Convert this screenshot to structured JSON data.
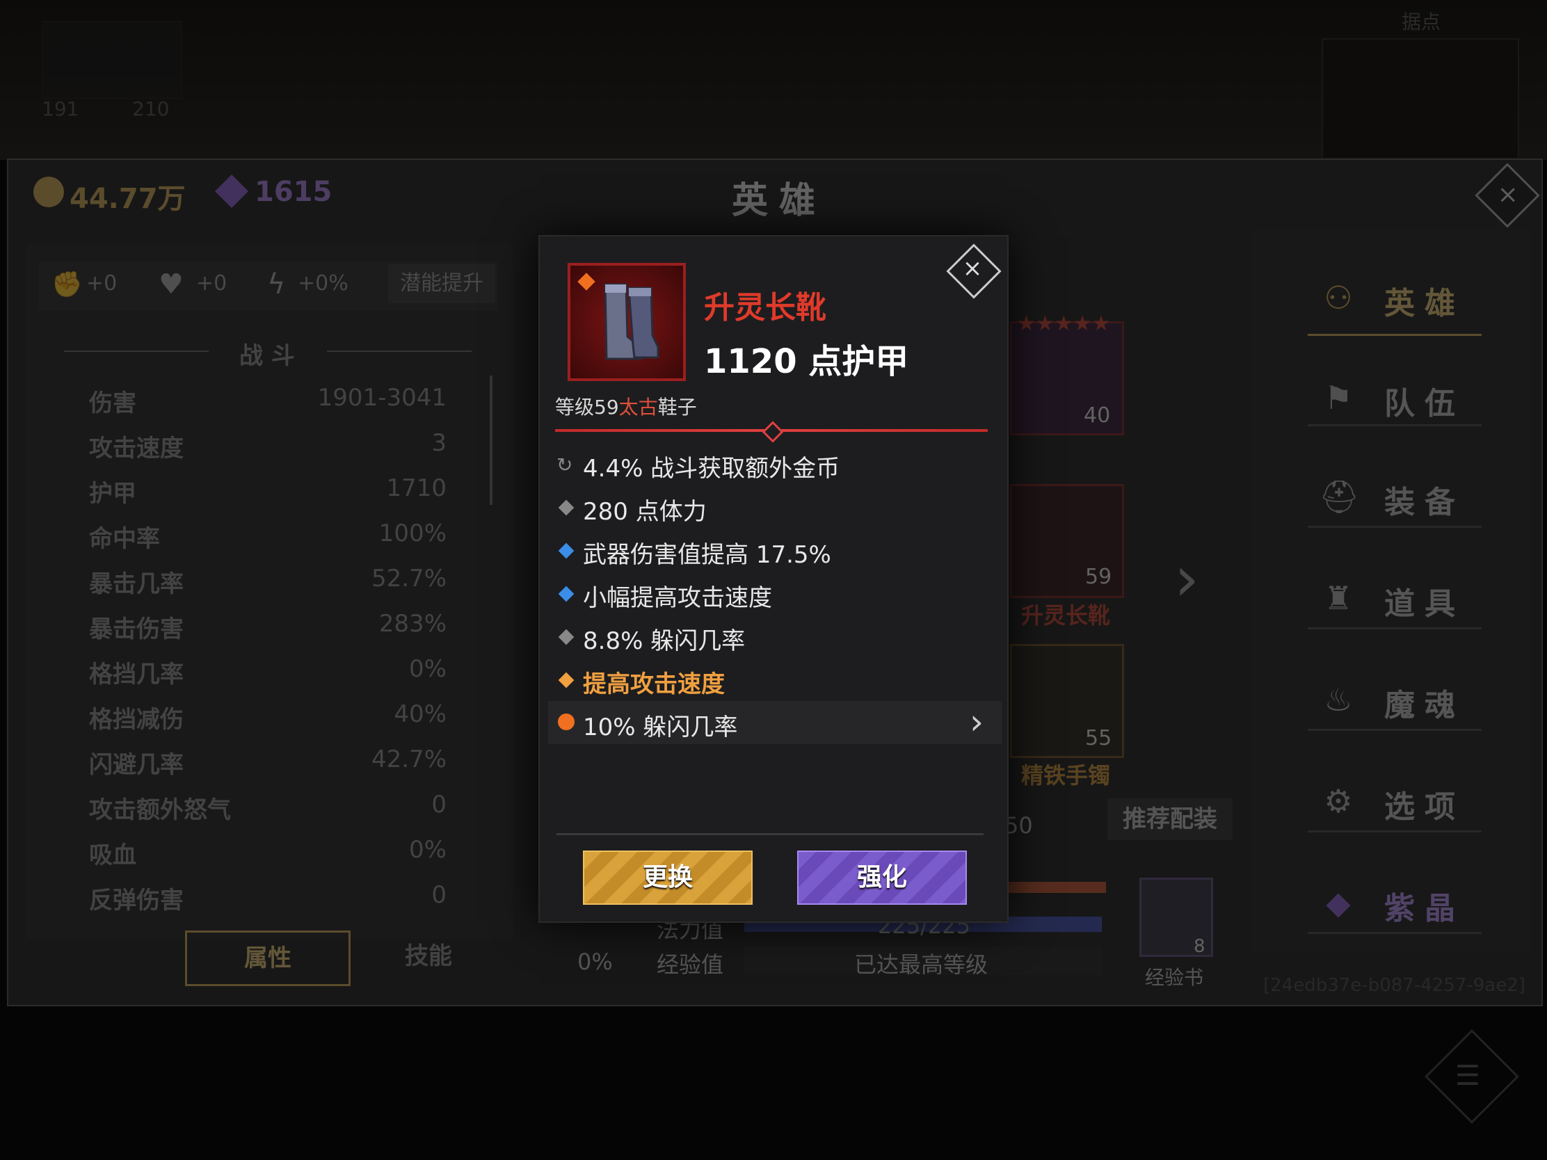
{
  "background": {
    "top_label": "据点",
    "left_stats": "191",
    "left_stats2": "210"
  },
  "header": {
    "gold": "44.77万",
    "gems": "1615",
    "title": "英雄",
    "close_icon": "close-icon"
  },
  "left_panel": {
    "bonuses": [
      "+0",
      "+0",
      "+0%"
    ],
    "potential_button": "潜能提升",
    "section_title": "战 斗",
    "stats": [
      {
        "label": "伤害",
        "value": "1901-3041"
      },
      {
        "label": "攻击速度",
        "value": "3"
      },
      {
        "label": "护甲",
        "value": "1710"
      },
      {
        "label": "命中率",
        "value": "100%"
      },
      {
        "label": "暴击几率",
        "value": "52.7%"
      },
      {
        "label": "暴击伤害",
        "value": "283%"
      },
      {
        "label": "格挡几率",
        "value": "0%"
      },
      {
        "label": "格挡减伤",
        "value": "40%"
      },
      {
        "label": "闪避几率",
        "value": "42.7%"
      },
      {
        "label": "攻击额外怒气",
        "value": "0"
      },
      {
        "label": "吸血",
        "value": "0%"
      },
      {
        "label": "反弹伤害",
        "value": "0"
      }
    ],
    "tabs": [
      "属性",
      "技能"
    ]
  },
  "hero_area": {
    "portrait_level": "40",
    "boots_level": "59",
    "boots_name": "升灵长靴",
    "bracelet_level": "55",
    "bracelet_name": "精铁手镯",
    "recommend_button": "推荐配装",
    "partial_number": "50",
    "mana_label": "法力值",
    "mana_value": "225/225",
    "exp_label": "经验值",
    "exp_value": "已达最高等级",
    "left_percent": "0%",
    "exp_book_count": "8",
    "exp_book_label": "经验书",
    "id_text": "[24edb37e-b087-4257-9ae2]"
  },
  "nav": [
    {
      "label": "英雄",
      "icon": "hero-icon"
    },
    {
      "label": "队伍",
      "icon": "flag-icon"
    },
    {
      "label": "装备",
      "icon": "helmet-icon"
    },
    {
      "label": "道具",
      "icon": "bag-icon"
    },
    {
      "label": "魔魂",
      "icon": "flame-icon"
    },
    {
      "label": "选项",
      "icon": "gear-icon"
    },
    {
      "label": "紫晶",
      "icon": "crystal-icon"
    }
  ],
  "popup": {
    "item_name": "升灵长靴",
    "main_stat": "1120 点护甲",
    "level_prefix": "等级59",
    "rarity": "太古",
    "slot_type": "鞋子",
    "affixes": [
      {
        "text": "4.4% 战斗获取额外金币",
        "bullet": "refresh",
        "color": "#888888"
      },
      {
        "text": "280 点体力",
        "bullet": "diamond",
        "color": "#888888"
      },
      {
        "text": "武器伤害值提高 17.5%",
        "bullet": "diamond",
        "color": "#3a8ee8"
      },
      {
        "text": "小幅提高攻击速度",
        "bullet": "diamond",
        "color": "#3a8ee8"
      },
      {
        "text": "8.8% 躲闪几率",
        "bullet": "diamond",
        "color": "#888888"
      },
      {
        "text": "提高攻击速度",
        "bullet": "diamond",
        "color": "#f0a040"
      },
      {
        "text": "10% 躲闪几率",
        "bullet": "gem",
        "color": "#f07020"
      }
    ],
    "buttons": {
      "replace": "更换",
      "enhance": "强化"
    }
  }
}
